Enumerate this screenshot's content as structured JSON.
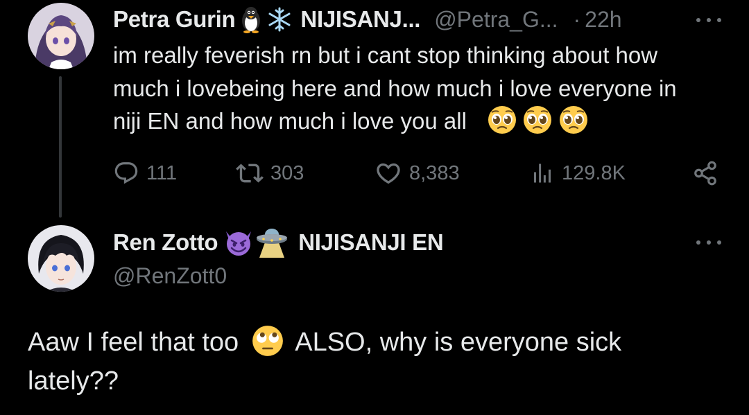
{
  "parent_tweet": {
    "author_name": "Petra Gurin",
    "badge_emojis": [
      "penguin",
      "snowflake"
    ],
    "affiliation": "NIJISANJ...",
    "handle": "@Petra_G...",
    "separator": "·",
    "time": "22h",
    "text_lines": [
      "im really feverish rn but i cant stop thinking about how",
      "much i lovebeing here and how much i love everyone in",
      "niji EN and how much i love you all"
    ],
    "text_emojis": [
      "pleading-face",
      "pleading-face",
      "pleading-face"
    ],
    "actions": {
      "replies": "111",
      "reposts": "303",
      "likes": "8,383",
      "views": "129.8K"
    }
  },
  "reply_tweet": {
    "author_name": "Ren Zotto",
    "badge_emojis": [
      "smiling-devil",
      "ufo"
    ],
    "affiliation": "NIJISANJI EN",
    "handle": "@RenZott0",
    "text_line_1_before": "Aaw I feel that too",
    "text_line_1_emoji": "rolling-eyes-face",
    "text_line_1_after": "ALSO, why is everyone sick",
    "text_line_2": "lately??"
  },
  "colors": {
    "background": "#000000",
    "primary_text": "#e7e9ea",
    "secondary_text": "#71767b",
    "thread_line": "#333639"
  },
  "icons": [
    "more-icon",
    "reply-icon",
    "repost-icon",
    "like-icon",
    "views-icon",
    "share-icon"
  ]
}
